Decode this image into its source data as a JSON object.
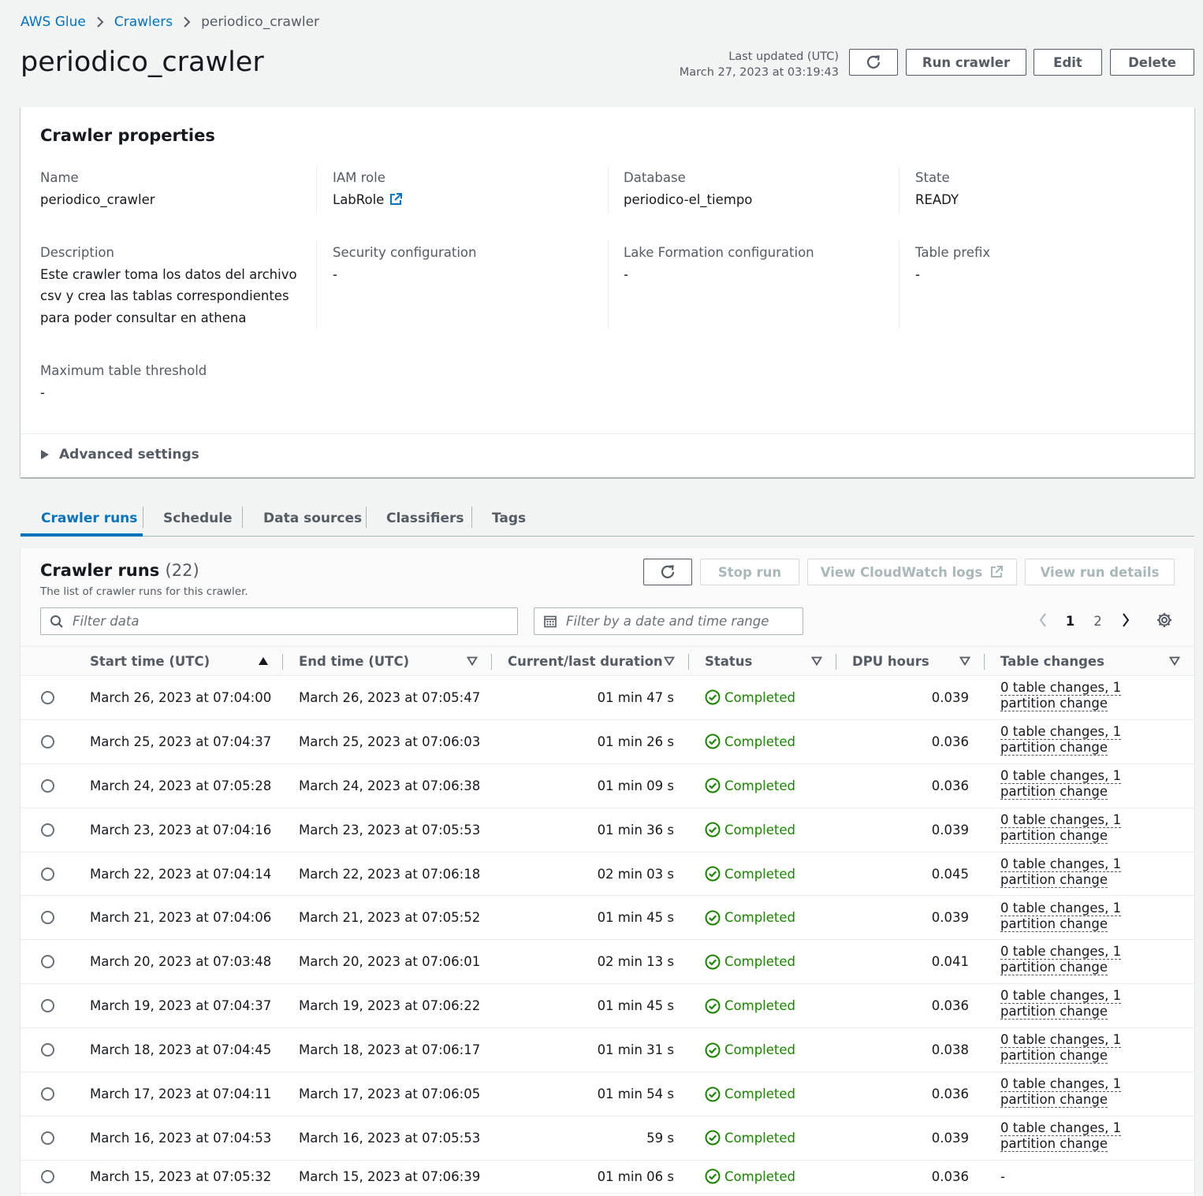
{
  "breadcrumb": {
    "items": [
      "AWS Glue",
      "Crawlers"
    ],
    "current": "periodico_crawler"
  },
  "header": {
    "title": "periodico_crawler",
    "last_updated_label": "Last updated (UTC)",
    "last_updated_value": "March 27, 2023 at 03:19:43",
    "run_crawler": "Run crawler",
    "edit": "Edit",
    "delete": "Delete"
  },
  "properties": {
    "title": "Crawler properties",
    "name_label": "Name",
    "name_value": "periodico_crawler",
    "iam_label": "IAM role",
    "iam_value": "LabRole",
    "database_label": "Database",
    "database_value": "periodico-el_tiempo",
    "state_label": "State",
    "state_value": "READY",
    "description_label": "Description",
    "description_lines": [
      "Este crawler toma los datos del archivo",
      "csv y crea las tablas correspondientes",
      "para poder consultar en athena"
    ],
    "security_label": "Security configuration",
    "security_value": "-",
    "lake_label": "Lake Formation configuration",
    "lake_value": "-",
    "prefix_label": "Table prefix",
    "prefix_value": "-",
    "threshold_label": "Maximum table threshold",
    "threshold_value": "-",
    "advanced": "Advanced settings"
  },
  "tabs": [
    "Crawler runs",
    "Schedule",
    "Data sources",
    "Classifiers",
    "Tags"
  ],
  "runs": {
    "title": "Crawler runs",
    "count": "(22)",
    "subtitle": "The list of crawler runs for this crawler.",
    "stop_run": "Stop run",
    "view_logs": "View CloudWatch logs",
    "view_details": "View run details",
    "filter_placeholder": "Filter data",
    "date_placeholder": "Filter by a date and time range",
    "pages": [
      "1",
      "2"
    ],
    "columns": [
      "Start time (UTC)",
      "End time (UTC)",
      "Current/last duration",
      "Status",
      "DPU hours",
      "Table changes"
    ],
    "rows": [
      {
        "start": "March 26, 2023 at 07:04:00",
        "end": "March 26, 2023 at 07:05:47",
        "duration": "01 min 47 s",
        "status": "Completed",
        "dpu": "0.039",
        "changes": "0 table changes, 1 partition change"
      },
      {
        "start": "March 25, 2023 at 07:04:37",
        "end": "March 25, 2023 at 07:06:03",
        "duration": "01 min 26 s",
        "status": "Completed",
        "dpu": "0.036",
        "changes": "0 table changes, 1 partition change"
      },
      {
        "start": "March 24, 2023 at 07:05:28",
        "end": "March 24, 2023 at 07:06:38",
        "duration": "01 min 09 s",
        "status": "Completed",
        "dpu": "0.036",
        "changes": "0 table changes, 1 partition change"
      },
      {
        "start": "March 23, 2023 at 07:04:16",
        "end": "March 23, 2023 at 07:05:53",
        "duration": "01 min 36 s",
        "status": "Completed",
        "dpu": "0.039",
        "changes": "0 table changes, 1 partition change"
      },
      {
        "start": "March 22, 2023 at 07:04:14",
        "end": "March 22, 2023 at 07:06:18",
        "duration": "02 min 03 s",
        "status": "Completed",
        "dpu": "0.045",
        "changes": "0 table changes, 1 partition change"
      },
      {
        "start": "March 21, 2023 at 07:04:06",
        "end": "March 21, 2023 at 07:05:52",
        "duration": "01 min 45 s",
        "status": "Completed",
        "dpu": "0.039",
        "changes": "0 table changes, 1 partition change"
      },
      {
        "start": "March 20, 2023 at 07:03:48",
        "end": "March 20, 2023 at 07:06:01",
        "duration": "02 min 13 s",
        "status": "Completed",
        "dpu": "0.041",
        "changes": "0 table changes, 1 partition change"
      },
      {
        "start": "March 19, 2023 at 07:04:37",
        "end": "March 19, 2023 at 07:06:22",
        "duration": "01 min 45 s",
        "status": "Completed",
        "dpu": "0.036",
        "changes": "0 table changes, 1 partition change"
      },
      {
        "start": "March 18, 2023 at 07:04:45",
        "end": "March 18, 2023 at 07:06:17",
        "duration": "01 min 31 s",
        "status": "Completed",
        "dpu": "0.038",
        "changes": "0 table changes, 1 partition change"
      },
      {
        "start": "March 17, 2023 at 07:04:11",
        "end": "March 17, 2023 at 07:06:05",
        "duration": "01 min 54 s",
        "status": "Completed",
        "dpu": "0.036",
        "changes": "0 table changes, 1 partition change"
      },
      {
        "start": "March 16, 2023 at 07:04:53",
        "end": "March 16, 2023 at 07:05:53",
        "duration": "59 s",
        "status": "Completed",
        "dpu": "0.039",
        "changes": "0 table changes, 1 partition change"
      },
      {
        "start": "March 15, 2023 at 07:05:32",
        "end": "March 15, 2023 at 07:06:39",
        "duration": "01 min 06 s",
        "status": "Completed",
        "dpu": "0.036",
        "changes": "-"
      }
    ]
  },
  "colors": {
    "link": "#0073bb",
    "success": "#1d8102",
    "text": "#16191f",
    "muted": "#545b64"
  }
}
